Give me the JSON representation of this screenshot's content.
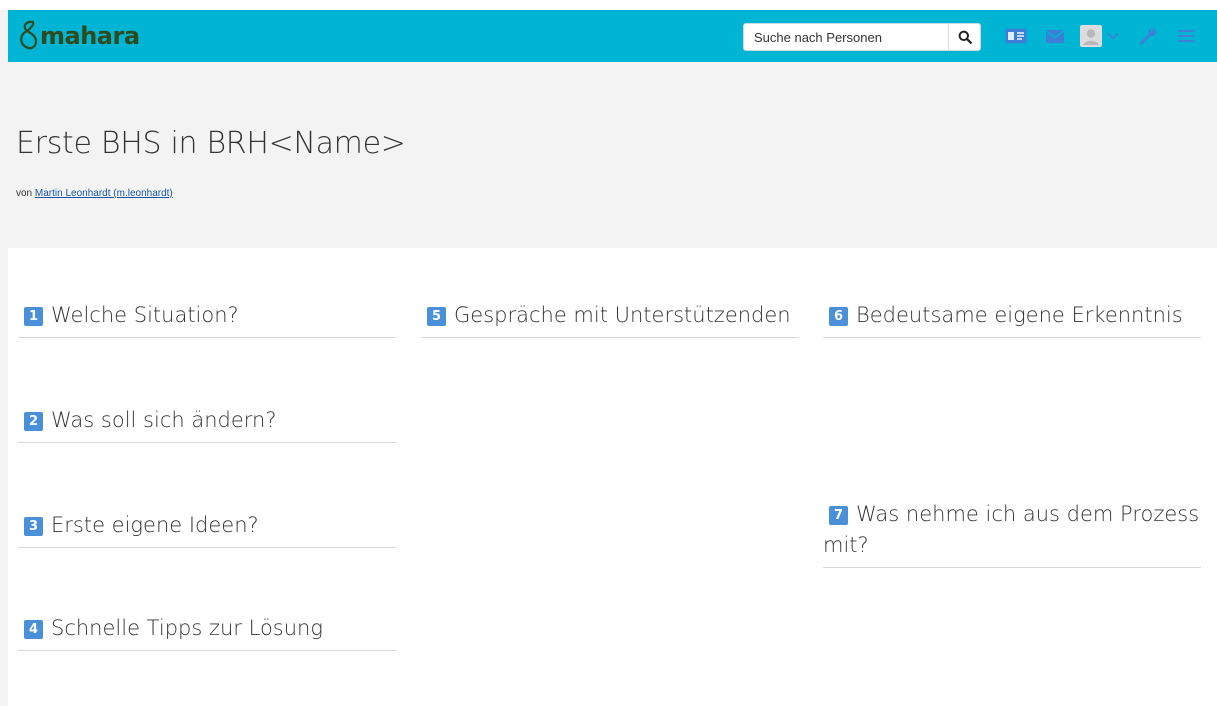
{
  "app": {
    "logo_text": "mahara"
  },
  "search": {
    "placeholder": "Suche nach Personen"
  },
  "page": {
    "title": "Erste BHS in BRH<Name>",
    "byline_prefix": "von",
    "author": "Martin Leonhardt (m.leonhardt)"
  },
  "blocks": [
    {
      "number": "1",
      "title": "Welche Situation?"
    },
    {
      "number": "2",
      "title": "Was soll sich ändern?"
    },
    {
      "number": "3",
      "title": "Erste eigene Ideen?"
    },
    {
      "number": "4",
      "title": "Schnelle Tipps zur Lösung"
    },
    {
      "number": "5",
      "title": "Gespräche mit Unterstützenden"
    },
    {
      "number": "6",
      "title": "Bedeutsame eigene Erkenntnis"
    },
    {
      "number": "7",
      "title": "Was nehme ich aus dem Prozess mit?"
    }
  ],
  "colors": {
    "navbar": "#00b4d3",
    "logo": "#2f4a1c",
    "number_badge": "#4a90d9",
    "header_band": "#f3f3f3",
    "link": "#1a56a8"
  },
  "icons": [
    "search-icon",
    "id-card-icon",
    "mail-icon",
    "user-avatar-icon",
    "chevron-down-icon",
    "wrench-icon",
    "menu-icon"
  ]
}
